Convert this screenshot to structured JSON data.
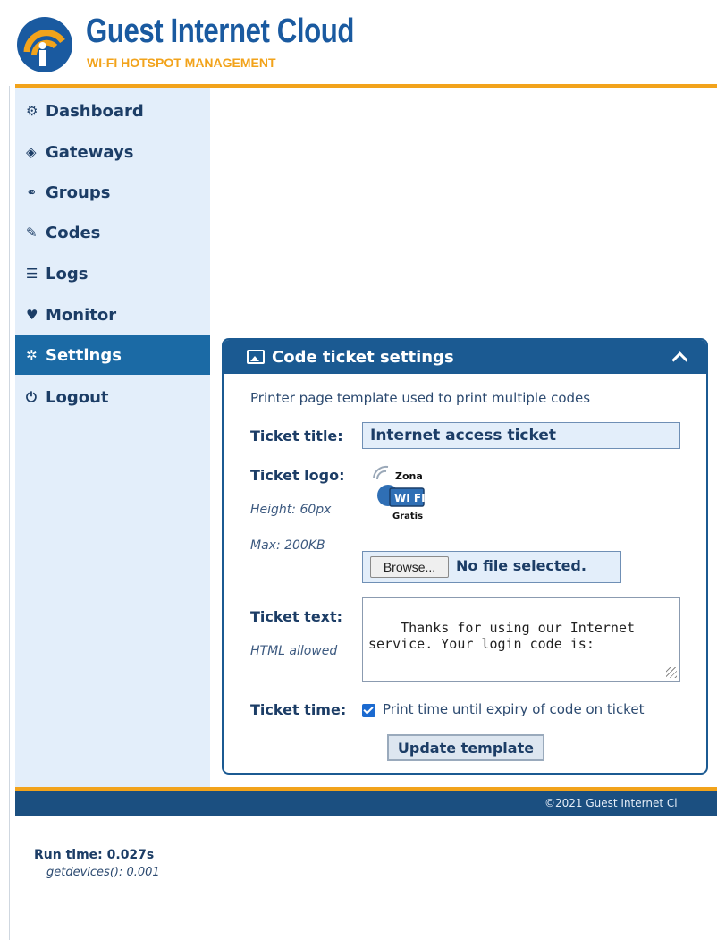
{
  "brand": {
    "name": "Guest Internet Cloud",
    "tagline": "WI-FI HOTSPOT MANAGEMENT",
    "colors": {
      "primary": "#1a5aa0",
      "accent": "#f2a31b"
    }
  },
  "sidebar": {
    "items": [
      {
        "label": "Dashboard",
        "icon": "dashboard-icon",
        "glyph": "⚙"
      },
      {
        "label": "Gateways",
        "icon": "cube-icon",
        "glyph": "◈"
      },
      {
        "label": "Groups",
        "icon": "groups-icon",
        "glyph": "⚭"
      },
      {
        "label": "Codes",
        "icon": "tags-icon",
        "glyph": "✎"
      },
      {
        "label": "Logs",
        "icon": "database-icon",
        "glyph": "☰"
      },
      {
        "label": "Monitor",
        "icon": "heartbeat-icon",
        "glyph": "♥"
      },
      {
        "label": "Settings",
        "icon": "cog-icon",
        "glyph": "✲",
        "active": true
      },
      {
        "label": "Logout",
        "icon": "power-icon",
        "glyph": "⏻"
      }
    ]
  },
  "card": {
    "title": "Code ticket settings",
    "header_icon": "image-icon",
    "collapse_icon": "chevron-up-icon",
    "intro": "Printer page template used to print multiple codes",
    "ticket_title_label": "Ticket title:",
    "ticket_title_value": "Internet access ticket",
    "ticket_logo_label": "Ticket logo:",
    "logo_height_hint": "Height: 60px",
    "logo_max_hint": "Max: 200KB",
    "logo_text_top": "Zona",
    "logo_text_mid": "WI FI",
    "logo_text_bottom": "Gratis",
    "browse_label": "Browse...",
    "file_status": "No file selected.",
    "ticket_text_label": "Ticket text:",
    "ticket_text_hint": "HTML allowed",
    "ticket_text_value": "Thanks for using our Internet\nservice. Your login code is:",
    "ticket_time_label": "Ticket time:",
    "ticket_time_checked": true,
    "ticket_time_option": "Print time until expiry of code on ticket",
    "update_label": "Update template"
  },
  "footer": {
    "copyright": "©2021 Guest Internet Cl"
  },
  "debug": {
    "runtime": "Run time: 0.027s",
    "sub": "getdevices(): 0.001"
  }
}
